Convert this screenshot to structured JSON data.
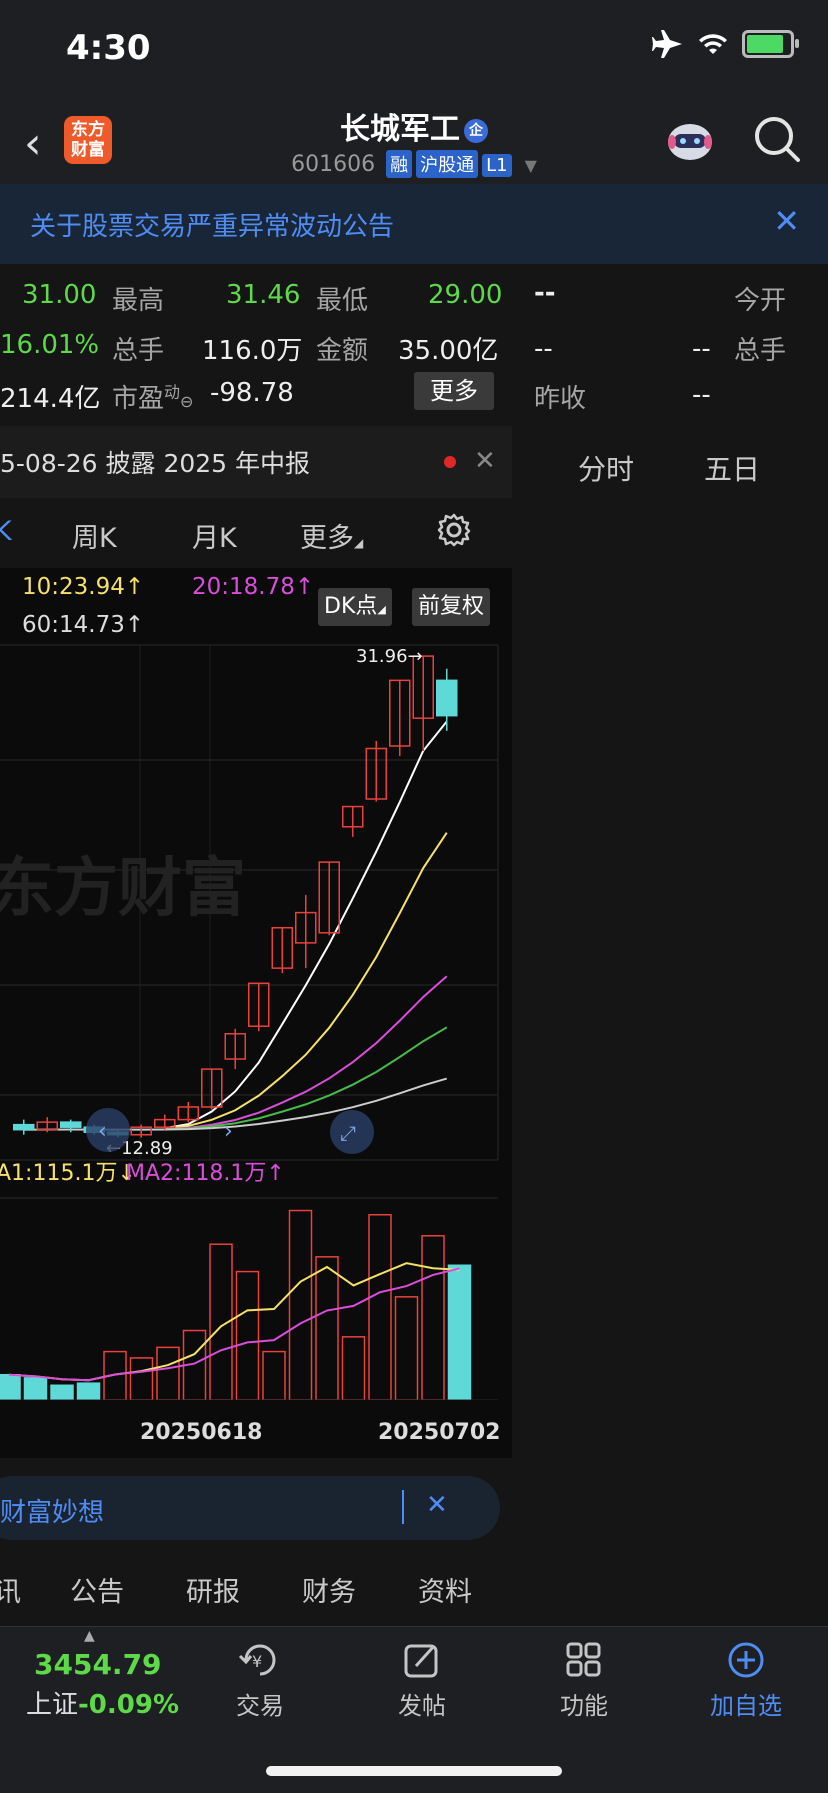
{
  "status": {
    "time": "4:30"
  },
  "header": {
    "stock_name": "长城军工",
    "enterprise_badge": "企",
    "code": "601606",
    "tags": [
      "融",
      "沪股通",
      "L1"
    ],
    "logo_text_line1": "东方",
    "logo_text_line2": "财富"
  },
  "banner": {
    "text": "关于股票交易严重异常波动公告",
    "close": "✕"
  },
  "quote": {
    "row1": {
      "v1": "31.00",
      "l2": "最高",
      "v2": "31.46",
      "l3": "最低",
      "v3": "29.00",
      "r_v": "--",
      "r_l": "今开"
    },
    "row2": {
      "v1": "16.01%",
      "l2": "总手",
      "v2": "116.0万",
      "l3": "金额",
      "v3": "35.00亿",
      "r_v1": "--",
      "r_v2": "--",
      "r_l": "总手"
    },
    "row3": {
      "v1": "214.4亿",
      "l2": "市盈",
      "l2_sup": "动",
      "v2": "-98.78",
      "more": "更多",
      "r_l": "昨收",
      "r_v": "--"
    }
  },
  "disclosure": {
    "text": "5-08-26 披露 2025 年中报",
    "close": "✕"
  },
  "right_tabs": [
    "分时",
    "五日"
  ],
  "periods": [
    "K",
    "周K",
    "月K",
    "更多"
  ],
  "ma_legend": {
    "ma10": "10:23.94↑",
    "ma20": "20:18.78↑",
    "ma60": "60:14.73↑",
    "dk_button": "DK点",
    "adjust_button": "前复权"
  },
  "chart_labels": {
    "high_marker": "31.96→",
    "low_marker": "←12.89",
    "watermark": "东方财富",
    "vol_ma1": "A1:115.1万↓",
    "vol_ma2": "MA2:118.1万↑",
    "date1": "20250618",
    "date2": "20250702"
  },
  "fortune": {
    "text": "财富妙想",
    "close": "✕"
  },
  "info_tabs": [
    "讯",
    "公告",
    "研报",
    "财务",
    "资料"
  ],
  "bottom": {
    "index_value": "3454.79",
    "index_name": "上证",
    "index_change": "-0.09%",
    "items": [
      "交易",
      "发帖",
      "功能",
      "加自选"
    ]
  },
  "colors": {
    "up": "#e8423d",
    "down": "#5fd8d8",
    "ma5": "#ffffff",
    "ma10": "#f5e16a",
    "ma20": "#d94ed9",
    "ma60": "#49b84a",
    "ma_long": "#cccccc",
    "accent": "#4f8df5",
    "green": "#5ed94a"
  },
  "chart_data": {
    "type": "candlestick",
    "y_range": [
      12.89,
      31.96
    ],
    "markers": {
      "high": 31.96,
      "low": 12.89
    },
    "x_ticks": [
      "20250618",
      "20250702"
    ],
    "candles": [
      {
        "o": 13.4,
        "c": 13.2,
        "h": 13.6,
        "l": 13.0
      },
      {
        "o": 13.2,
        "c": 13.5,
        "h": 13.7,
        "l": 13.1
      },
      {
        "o": 13.5,
        "c": 13.3,
        "h": 13.6,
        "l": 13.1
      },
      {
        "o": 13.3,
        "c": 13.1,
        "h": 13.4,
        "l": 13.0
      },
      {
        "o": 13.1,
        "c": 13.0,
        "h": 13.2,
        "l": 12.9
      },
      {
        "o": 13.0,
        "c": 13.3,
        "h": 13.4,
        "l": 12.89
      },
      {
        "o": 13.3,
        "c": 13.6,
        "h": 13.8,
        "l": 13.2
      },
      {
        "o": 13.6,
        "c": 14.1,
        "h": 14.3,
        "l": 13.5
      },
      {
        "o": 14.1,
        "c": 15.6,
        "h": 15.6,
        "l": 14.0
      },
      {
        "o": 16.0,
        "c": 17.0,
        "h": 17.2,
        "l": 15.6
      },
      {
        "o": 17.3,
        "c": 19.0,
        "h": 19.0,
        "l": 17.1
      },
      {
        "o": 19.6,
        "c": 21.2,
        "h": 21.2,
        "l": 19.4
      },
      {
        "o": 20.6,
        "c": 21.8,
        "h": 22.5,
        "l": 19.6
      },
      {
        "o": 21.0,
        "c": 23.8,
        "h": 23.8,
        "l": 20.9
      },
      {
        "o": 25.2,
        "c": 26.0,
        "h": 26.0,
        "l": 24.8
      },
      {
        "o": 26.3,
        "c": 28.3,
        "h": 28.6,
        "l": 26.2
      },
      {
        "o": 28.4,
        "c": 31.0,
        "h": 31.0,
        "l": 28.0
      },
      {
        "o": 29.5,
        "c": 31.96,
        "h": 31.96,
        "l": 28.2
      },
      {
        "o": 31.0,
        "c": 29.6,
        "h": 31.46,
        "l": 29.0
      }
    ],
    "volume": [
      {
        "v": 120,
        "up": false
      },
      {
        "v": 105,
        "up": false
      },
      {
        "v": 70,
        "up": false
      },
      {
        "v": 80,
        "up": false
      },
      {
        "v": 230,
        "up": true
      },
      {
        "v": 200,
        "up": true
      },
      {
        "v": 250,
        "up": true
      },
      {
        "v": 330,
        "up": true
      },
      {
        "v": 740,
        "up": true
      },
      {
        "v": 610,
        "up": true
      },
      {
        "v": 230,
        "up": true
      },
      {
        "v": 900,
        "up": true
      },
      {
        "v": 680,
        "up": true
      },
      {
        "v": 300,
        "up": true
      },
      {
        "v": 880,
        "up": true
      },
      {
        "v": 490,
        "up": true
      },
      {
        "v": 780,
        "up": true
      },
      {
        "v": 640,
        "up": false
      }
    ]
  }
}
